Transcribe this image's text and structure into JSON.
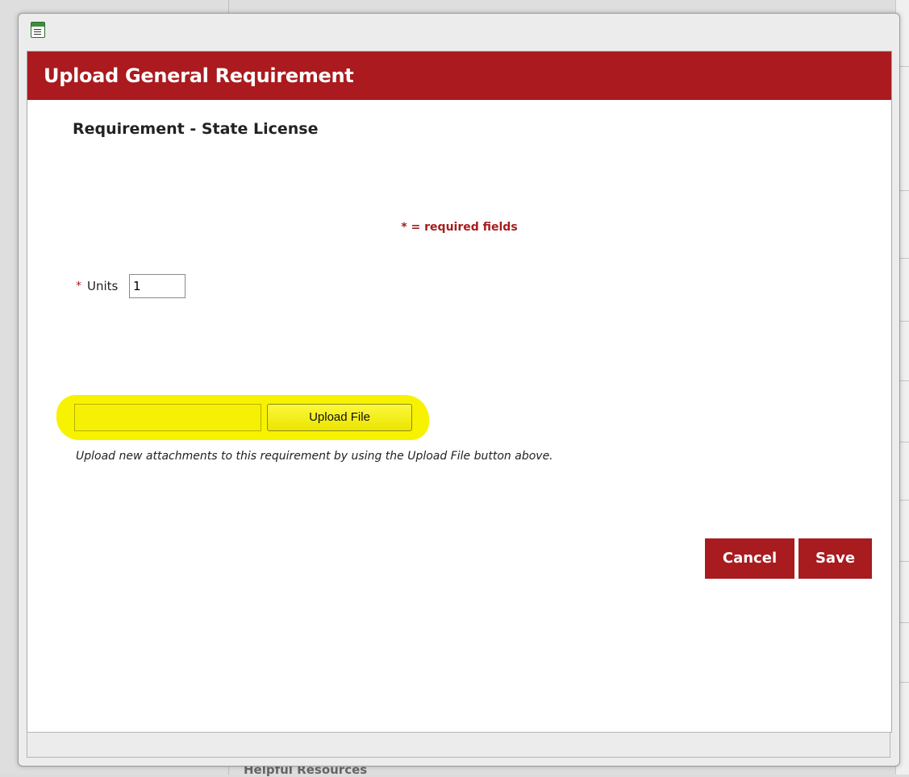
{
  "background": {
    "footer_text": "Helpful Resources"
  },
  "dialog": {
    "header_title": "Upload General Requirement",
    "requirement_title": "Requirement - State License",
    "required_note": "* = required fields",
    "units": {
      "required_marker": "*",
      "label": "Units",
      "value": "1"
    },
    "upload": {
      "file_value": "",
      "button_label": "Upload File",
      "help_text": "Upload new attachments to this requirement by using the Upload File button above."
    },
    "buttons": {
      "cancel": "Cancel",
      "save": "Save"
    }
  },
  "colors": {
    "brand_red": "#aa1a1e",
    "highlight_yellow": "#f7f200"
  },
  "icons": {
    "app": "form-window-icon"
  }
}
